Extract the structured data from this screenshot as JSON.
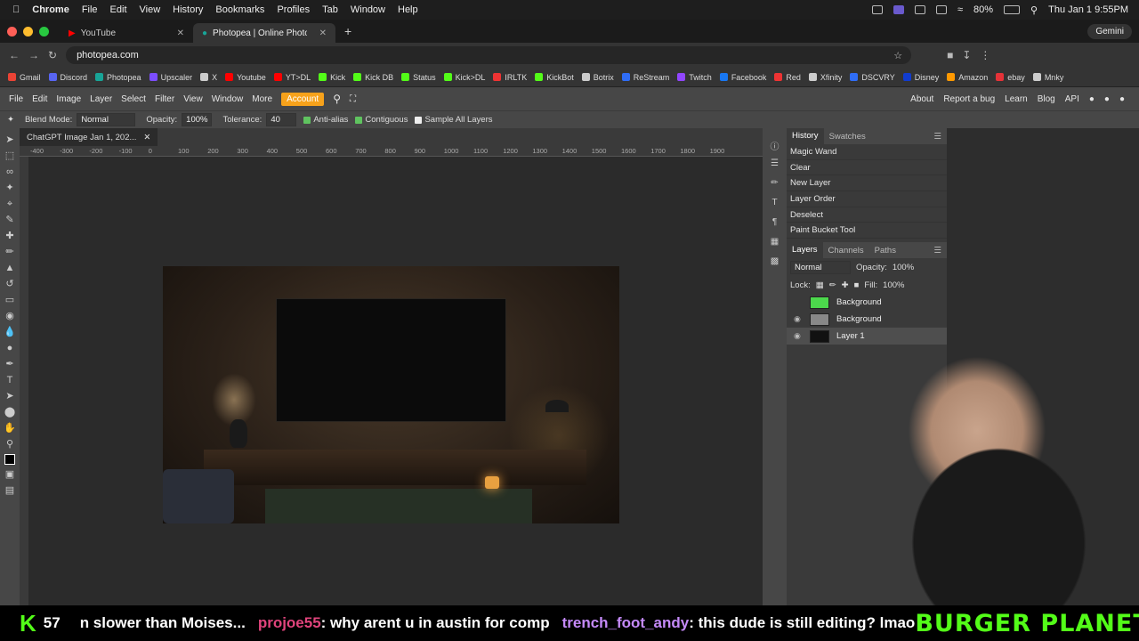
{
  "macmenu": {
    "app": "Chrome",
    "items": [
      "File",
      "Edit",
      "View",
      "History",
      "Bookmarks",
      "Profiles",
      "Tab",
      "Window",
      "Help"
    ],
    "battery": "80%",
    "clock": "Thu Jan 1  9:55PM"
  },
  "tabs": [
    {
      "label": "YouTube"
    },
    {
      "label": "Photopea | Online Photo Edit"
    }
  ],
  "gemini": "Gemini",
  "url": "photopea.com",
  "bookmarks": [
    {
      "label": "Gmail",
      "color": "#ea4335"
    },
    {
      "label": "Discord",
      "color": "#5865f2"
    },
    {
      "label": "Photopea",
      "color": "#18a497"
    },
    {
      "label": "Upscaler",
      "color": "#7c4dff"
    },
    {
      "label": "X",
      "color": "#cccccc"
    },
    {
      "label": "Youtube",
      "color": "#ff0000"
    },
    {
      "label": "YT>DL",
      "color": "#ff0000"
    },
    {
      "label": "Kick",
      "color": "#53fc18"
    },
    {
      "label": "Kick DB",
      "color": "#53fc18"
    },
    {
      "label": "Status",
      "color": "#53fc18"
    },
    {
      "label": "Kick>DL",
      "color": "#53fc18"
    },
    {
      "label": "IRLTK",
      "color": "#e33"
    },
    {
      "label": "KickBot",
      "color": "#53fc18"
    },
    {
      "label": "Botrix",
      "color": "#cccccc"
    },
    {
      "label": "ReStream",
      "color": "#2f6df6"
    },
    {
      "label": "Twitch",
      "color": "#9146ff"
    },
    {
      "label": "Facebook",
      "color": "#1877f2"
    },
    {
      "label": "Red",
      "color": "#e33"
    },
    {
      "label": "Xfinity",
      "color": "#cccccc"
    },
    {
      "label": "DSCVRY",
      "color": "#2f6df6"
    },
    {
      "label": "Disney",
      "color": "#113ccf"
    },
    {
      "label": "Amazon",
      "color": "#ff9900"
    },
    {
      "label": "ebay",
      "color": "#e53238"
    },
    {
      "label": "Mnky",
      "color": "#cccccc"
    }
  ],
  "ppmenu": {
    "items": [
      "File",
      "Edit",
      "Image",
      "Layer",
      "Select",
      "Filter",
      "View",
      "Window",
      "More"
    ],
    "account": "Account",
    "right": [
      "About",
      "Report a bug",
      "Learn",
      "Blog",
      "API"
    ]
  },
  "options": {
    "blend_label": "Blend Mode:",
    "blend_value": "Normal",
    "opacity_label": "Opacity:",
    "opacity_value": "100%",
    "tolerance_label": "Tolerance:",
    "tolerance_value": "40",
    "antialias": "Anti-alias",
    "contiguous": "Contiguous",
    "sample_all": "Sample All Layers"
  },
  "document": {
    "tab": "ChatGPT Image Jan 1, 202..."
  },
  "ruler": [
    "-400",
    "-300",
    "-200",
    "-100",
    "0",
    "100",
    "200",
    "300",
    "400",
    "500",
    "600",
    "700",
    "800",
    "900",
    "1000",
    "1100",
    "1200",
    "1300",
    "1400",
    "1500",
    "1600",
    "1700",
    "1800",
    "1900"
  ],
  "history": {
    "tabs": [
      "History",
      "Swatches"
    ],
    "items": [
      "Magic Wand",
      "Clear",
      "New Layer",
      "Layer Order",
      "Deselect",
      "Paint Bucket Tool"
    ]
  },
  "layers": {
    "tabs": [
      "Layers",
      "Channels",
      "Paths"
    ],
    "blend": "Normal",
    "opacity_label": "Opacity:",
    "opacity": "100%",
    "lock_label": "Lock:",
    "fill_label": "Fill:",
    "fill": "100%",
    "items": [
      {
        "name": "Background",
        "thumb": "#4cd84c"
      },
      {
        "name": "Background",
        "thumb": "#888888"
      },
      {
        "name": "Layer 1",
        "thumb": "#111111"
      }
    ]
  },
  "ticker": {
    "count": "57",
    "msg0": "n slower than Moises...",
    "user1": "projoe55",
    "msg1": ": why arent u in austin for comp",
    "user2": "trench_foot_andy",
    "msg2": ": this dude is still editing? lmao",
    "brand": "BURGER PLANET"
  }
}
